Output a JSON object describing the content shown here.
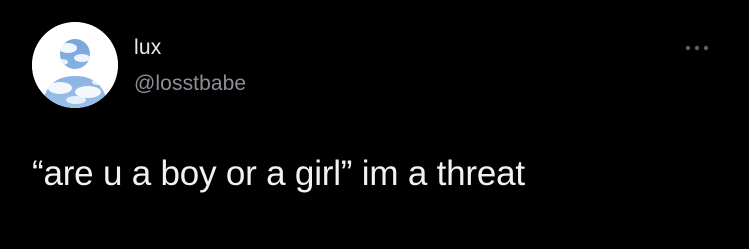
{
  "tweet": {
    "author": {
      "display_name": "lux",
      "handle": "@losstbabe",
      "avatar_icon": "sky-clouds-silhouette-avatar"
    },
    "more_icon": "more-horizontal-icon",
    "text": "“are u a boy or a girl” im a threat"
  },
  "colors": {
    "background": "#000000",
    "primary_text": "#e7e9ea",
    "secondary_text": "#8b8f95",
    "avatar_sky": "#7fa8dc"
  }
}
